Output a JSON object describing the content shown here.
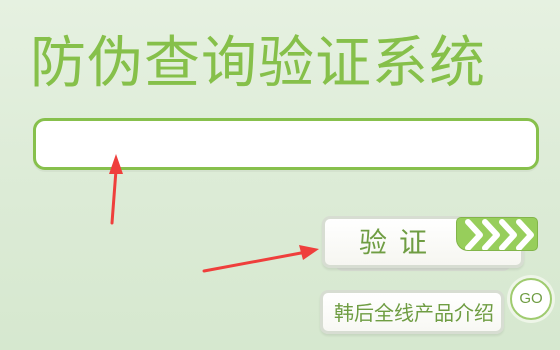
{
  "page": {
    "title": "防伪查询验证系统"
  },
  "form": {
    "input_value": "",
    "input_placeholder": ""
  },
  "buttons": {
    "verify_label": "验证",
    "shop_label": "韩后全线产品介绍",
    "go_label": "GO"
  },
  "icons": {
    "verify_arrows": "chevron-arrows-icon",
    "annotation_arrow_up": "red-arrow-up-icon",
    "annotation_arrow_right": "red-arrow-right-icon"
  },
  "colors": {
    "accent_green": "#87c04c",
    "text_green": "#6f9d43",
    "arrow_green": "#97ce5b",
    "annotation_red": "#ef3f3c",
    "background": "#dcebd6"
  }
}
